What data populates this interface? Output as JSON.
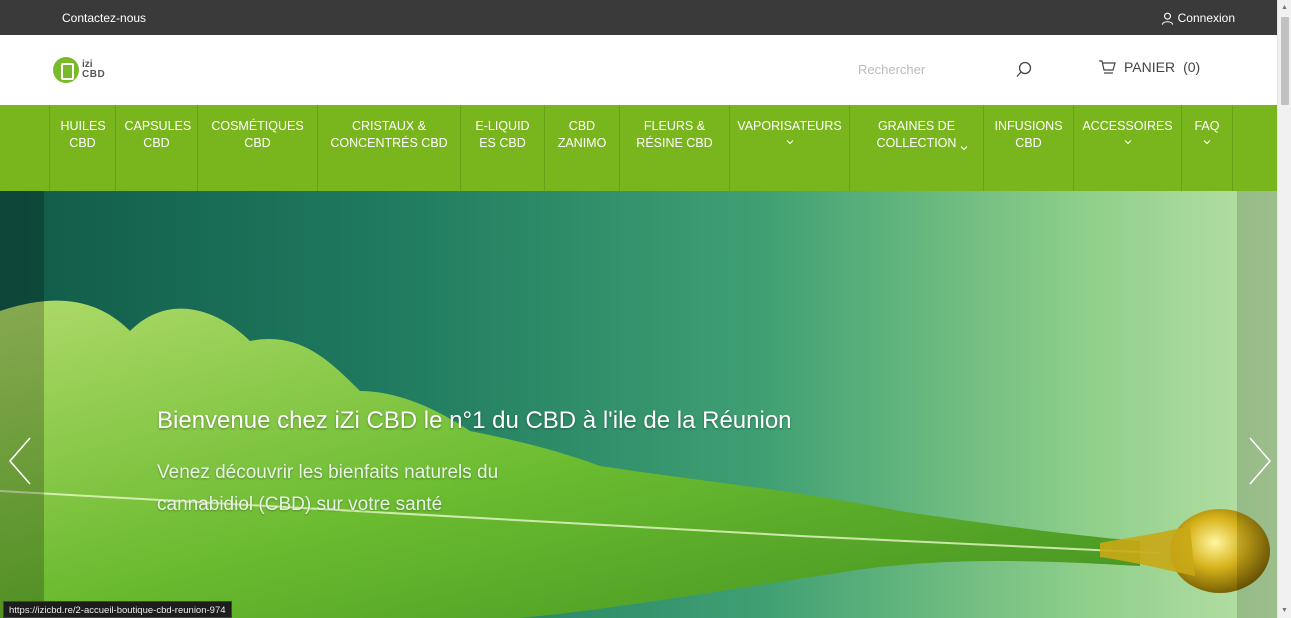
{
  "topbar": {
    "contact": "Contactez-nous",
    "login": "Connexion"
  },
  "header": {
    "logo": {
      "line1": "izi",
      "line2": "CBD"
    },
    "search_placeholder": "Rechercher",
    "cart_label": "PANIER",
    "cart_count": "(0)"
  },
  "nav": {
    "items": [
      {
        "label": "HUILES CBD"
      },
      {
        "label": "CAPSULES CBD"
      },
      {
        "label": "COSMÉTIQUES CBD"
      },
      {
        "label": "CRISTAUX & CONCENTRÉS CBD"
      },
      {
        "label": "E-LIQUIDES CBD"
      },
      {
        "label": "CBD ZANIMO"
      },
      {
        "label": "FLEURS & RÉSINE CBD"
      },
      {
        "label": "VAPORISATEURS"
      },
      {
        "label": "GRAINES DE COLLECTION"
      },
      {
        "label": "INFUSIONS CBD"
      },
      {
        "label": "ACCESSOIRES"
      },
      {
        "label": "FAQ"
      }
    ]
  },
  "hero": {
    "title": "Bienvenue chez iZi CBD le n°1 du CBD à l'ile de la Réunion",
    "subtitle": "Venez découvrir les bienfaits naturels du cannabidiol (CBD) sur votre santé"
  },
  "status_url": "https://izicbd.re/2-accueil-boutique-cbd-reunion-974",
  "colors": {
    "brand_green": "#79b51c",
    "topbar": "#3a3a3a"
  },
  "icons": {
    "login": "user-icon",
    "search": "search-icon",
    "cart": "cart-icon",
    "prev": "chevron-left-icon",
    "next": "chevron-right-icon"
  }
}
